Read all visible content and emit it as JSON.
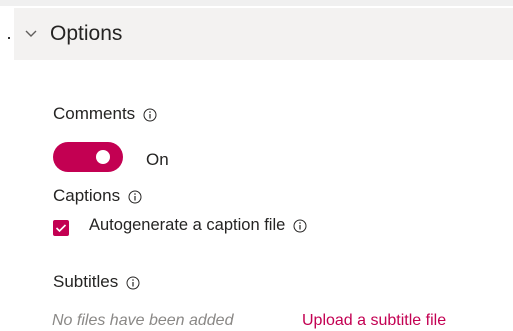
{
  "section": {
    "title": "Options",
    "chevron_icon": "chevron-down-icon"
  },
  "comments": {
    "label": "Comments",
    "info_icon": "info-icon",
    "toggle_state": "On",
    "toggle_on": true
  },
  "captions": {
    "label": "Captions",
    "info_icon": "info-icon",
    "checkbox_label": "Autogenerate a caption file",
    "checked": true
  },
  "subtitles": {
    "label": "Subtitles",
    "info_icon": "info-icon",
    "empty_text": "No files have been added",
    "upload_label": "Upload a subtitle file"
  },
  "colors": {
    "accent": "#c30052",
    "header_bg": "#f3f2f1",
    "muted_text": "#8a8886",
    "text": "#252423"
  }
}
